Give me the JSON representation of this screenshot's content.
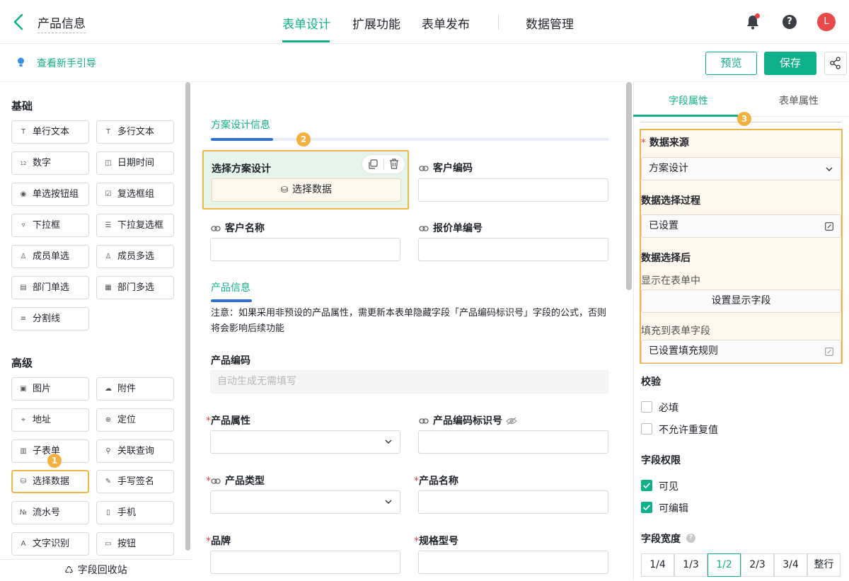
{
  "header": {
    "title": "产品信息",
    "tabs": [
      "表单设计",
      "扩展功能",
      "表单发布",
      "数据管理"
    ],
    "avatar_initial": "L",
    "help_symbol": "?"
  },
  "subbar": {
    "guide": "查看新手引导",
    "preview": "预览",
    "save": "保存"
  },
  "left": {
    "basic_title": "基础",
    "basic": [
      {
        "label": "单行文本",
        "icon": "T"
      },
      {
        "label": "多行文本",
        "icon": "T"
      },
      {
        "label": "数字",
        "icon": "12"
      },
      {
        "label": "日期时间",
        "icon": "◫"
      },
      {
        "label": "单选按钮组",
        "icon": "◉"
      },
      {
        "label": "复选框组",
        "icon": "☑"
      },
      {
        "label": "下拉框",
        "icon": "▿"
      },
      {
        "label": "下拉复选框",
        "icon": "☰"
      },
      {
        "label": "成员单选",
        "icon": "♙"
      },
      {
        "label": "成员多选",
        "icon": "♙"
      },
      {
        "label": "部门单选",
        "icon": "▤"
      },
      {
        "label": "部门多选",
        "icon": "▦"
      },
      {
        "label": "分割线",
        "icon": "≡"
      }
    ],
    "advanced_title": "高级",
    "advanced": [
      {
        "label": "图片",
        "icon": "▣"
      },
      {
        "label": "附件",
        "icon": "☁"
      },
      {
        "label": "地址",
        "icon": "⌖"
      },
      {
        "label": "定位",
        "icon": "⊕"
      },
      {
        "label": "子表单",
        "icon": "▥"
      },
      {
        "label": "关联查询",
        "icon": "⚲"
      },
      {
        "label": "选择数据",
        "icon": "⛁"
      },
      {
        "label": "手写签名",
        "icon": "✎"
      },
      {
        "label": "流水号",
        "icon": "№"
      },
      {
        "label": "手机",
        "icon": "▯"
      },
      {
        "label": "文字识别",
        "icon": "A"
      },
      {
        "label": "按钮",
        "icon": "▭"
      }
    ],
    "recycle": "字段回收站"
  },
  "badges": {
    "one": "1",
    "two": "2",
    "three": "3"
  },
  "center": {
    "section1": "方案设计信息",
    "select_label": "选择方案设计",
    "select_button": "选择数据",
    "customer_code": "客户编码",
    "customer_name": "客户名称",
    "quote_no": "报价单编号",
    "section2": "产品信息",
    "note": "注意：如果采用非预设的产品属性，需更新本表单隐藏字段「产品编码标识号」字段的公式，否则将会影响后续功能",
    "product_code": "产品编码",
    "product_code_placeholder": "自动生成无需填写",
    "product_attr": "产品属性",
    "product_code_id": "产品编码标识号",
    "product_type": "产品类型",
    "product_name": "产品名称",
    "brand": "品牌",
    "spec": "规格型号",
    "required_mark": "*"
  },
  "right": {
    "tabs": [
      "字段属性",
      "表单属性"
    ],
    "data_source_label": "数据来源",
    "data_source_value": "方案设计",
    "process_label": "数据选择过程",
    "process_value": "已设置",
    "after_label": "数据选择后",
    "show_in_form": "显示在表单中",
    "set_display": "设置显示字段",
    "fill_to_form": "填充到表单字段",
    "fill_rule": "已设置填充规则",
    "validation": "校验",
    "required": "必填",
    "no_dup": "不允许重复值",
    "permission": "字段权限",
    "visible": "可见",
    "editable": "可编辑",
    "width_label": "字段宽度",
    "widths": [
      "1/4",
      "1/3",
      "1/2",
      "2/3",
      "3/4",
      "整行"
    ],
    "width_selected": "1/2",
    "checks": {
      "required": false,
      "no_dup": false,
      "visible": true,
      "editable": true
    }
  },
  "colors": {
    "accent": "#10b08a",
    "highlight": "#f0b44b",
    "badge": "#f3b03e",
    "required": "#e03e3e",
    "section_bar": "#2f6fd6"
  }
}
